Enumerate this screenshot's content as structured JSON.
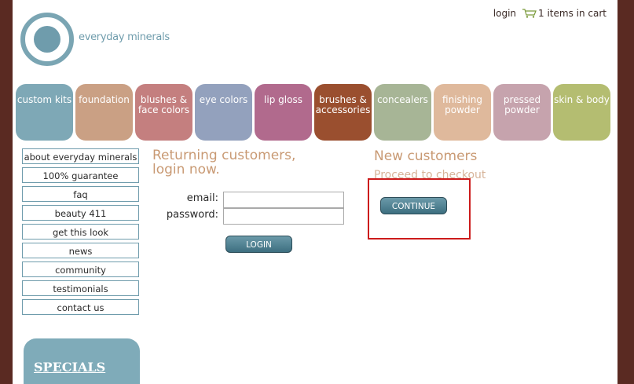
{
  "brand": {
    "name": "everyday minerals"
  },
  "header": {
    "login": "login",
    "cart": "1 items in cart"
  },
  "tabs": [
    {
      "label": "custom kits",
      "color": "#7ea8b6"
    },
    {
      "label": "foundation",
      "color": "#caa084"
    },
    {
      "label": "blushes & face colors",
      "color": "#c47f7f"
    },
    {
      "label": "eye colors",
      "color": "#93a1bd"
    },
    {
      "label": "lip gloss",
      "color": "#b16a8d"
    },
    {
      "label": "brushes & accessories",
      "color": "#9a4f2f"
    },
    {
      "label": "concealers",
      "color": "#a7b596"
    },
    {
      "label": "finishing powder",
      "color": "#dfb99c"
    },
    {
      "label": "pressed powder",
      "color": "#c6a3ad"
    },
    {
      "label": "skin & body",
      "color": "#b4bd71"
    }
  ],
  "sidebar": {
    "items": [
      "about everyday minerals",
      "100% guarantee",
      "faq",
      "beauty 411",
      "get this look",
      "news",
      "community",
      "testimonials",
      "contact us"
    ]
  },
  "specials": {
    "title": "SPECIALS"
  },
  "returning": {
    "title": "Returning customers, login now.",
    "email_label": "email:",
    "password_label": "password:",
    "login_button": "LOGIN"
  },
  "new_customers": {
    "title": "New customers",
    "subtitle": "Proceed to checkout",
    "continue_button": "CONTINUE"
  }
}
